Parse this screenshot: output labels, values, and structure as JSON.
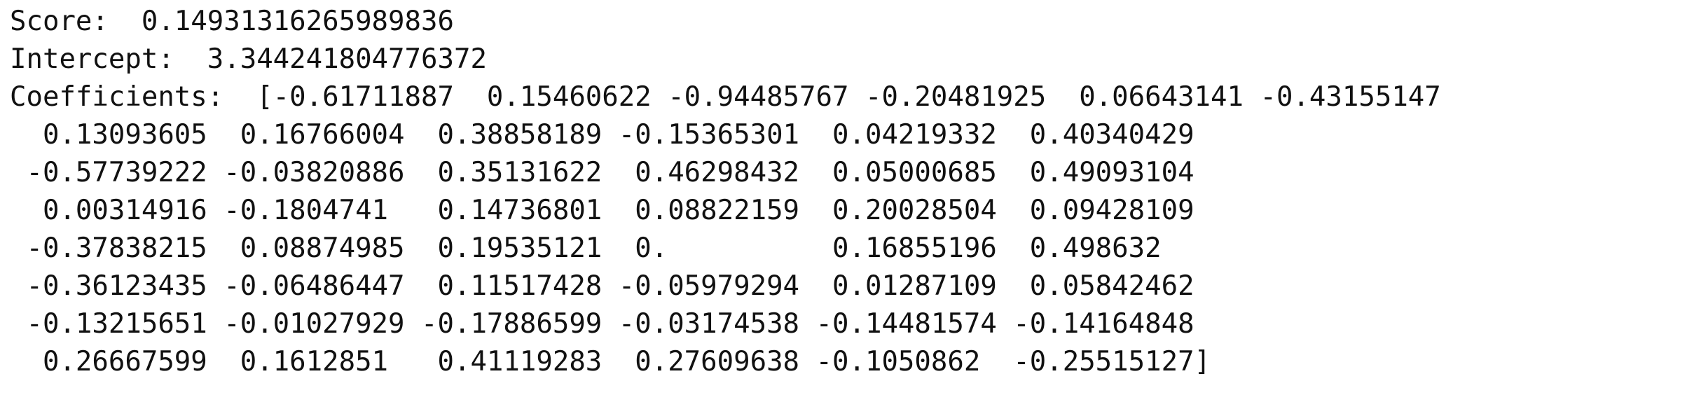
{
  "console": {
    "lines": [
      "Score:  0.14931316265989836",
      "Intercept:  3.344241804776372",
      "Coefficients:  [-0.61711887  0.15460622 -0.94485767 -0.20481925  0.06643141 -0.43155147",
      "  0.13093605  0.16766004  0.38858189 -0.15365301  0.04219332  0.40340429",
      " -0.57739222 -0.03820886  0.35131622  0.46298432  0.05000685  0.49093104",
      "  0.00314916 -0.1804741   0.14736801  0.08822159  0.20028504  0.09428109",
      " -0.37838215  0.08874985  0.19535121  0.          0.16855196  0.498632",
      " -0.36123435 -0.06486447  0.11517428 -0.05979294  0.01287109  0.05842462",
      " -0.13215651 -0.01027929 -0.17886599 -0.03174538 -0.14481574 -0.14164848",
      "  0.26667599  0.1612851   0.41119283  0.27609638 -0.1050862  -0.25515127]"
    ]
  }
}
